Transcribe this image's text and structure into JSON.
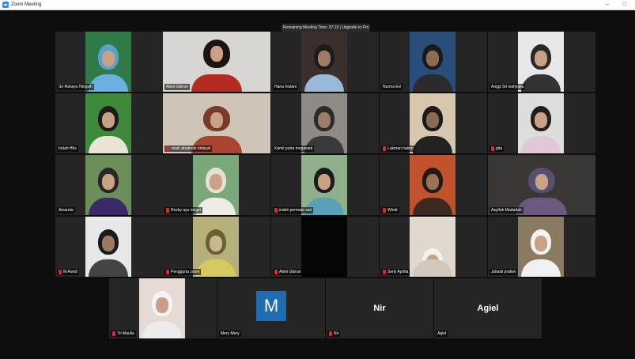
{
  "window": {
    "title": "Zoom Meeting",
    "minimize": "–",
    "maximize": "□"
  },
  "banner": {
    "text": "Remaining Meeting Time: 07:19 | Upgrade to Pro"
  },
  "participants": [
    {
      "name": "Sri Rahayu Ningsih",
      "muted": false
    },
    {
      "name": "Abiel Gibran",
      "muted": false,
      "active": true
    },
    {
      "name": "Hana Instani",
      "muted": false
    },
    {
      "name": "Nurma Evi",
      "muted": false
    },
    {
      "name": "Anggi Sri wahyuka",
      "muted": false
    },
    {
      "name": "Indah Hhs",
      "muted": false
    },
    {
      "name": "nisah pbatinah hidayat",
      "muted": true
    },
    {
      "name": "Kamil putra megawati",
      "muted": false
    },
    {
      "name": "Lukman hakim",
      "muted": true
    },
    {
      "name": "gita",
      "muted": true
    },
    {
      "name": "Amanda",
      "muted": false
    },
    {
      "name": "Rezky ayu ningsi",
      "muted": true
    },
    {
      "name": "indah permata sari",
      "muted": true
    },
    {
      "name": "Windi",
      "muted": true
    },
    {
      "name": "Asyifah Madadah",
      "muted": false
    },
    {
      "name": "M Asedi",
      "muted": true
    },
    {
      "name": "Pengguna zoom",
      "muted": true
    },
    {
      "name": "Abiel Gibran",
      "muted": true
    },
    {
      "name": "Serly Aprilia",
      "muted": true
    },
    {
      "name": "Juliasti pratiwi",
      "muted": false
    },
    {
      "name": "Tri Maulia",
      "muted": true
    },
    {
      "name": "Mery Mery",
      "muted": false,
      "avatar_letter": "M"
    },
    {
      "name": "Nir",
      "muted": true,
      "center_label": "Nir"
    },
    {
      "name": "Agiel",
      "muted": false,
      "center_label": "Agiel"
    }
  ],
  "colors": {
    "accent_active": "#c9d84a",
    "mute_red": "#e02828",
    "avatar_blue": "#1f6db0"
  }
}
